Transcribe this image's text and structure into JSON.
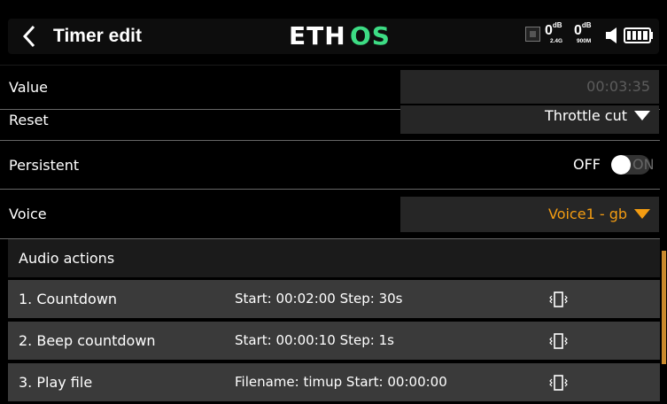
{
  "header": {
    "title": "Timer edit",
    "logo_text": "ETHOS",
    "signal1_value": "0",
    "signal1_unit": "dB",
    "signal1_band": "2.4G",
    "signal2_value": "0",
    "signal2_unit": "dB",
    "signal2_band": "900M",
    "icons": [
      "back-arrow-icon",
      "receiver-icon",
      "speaker-icon",
      "battery-icon"
    ]
  },
  "value_row": {
    "label": "Value",
    "value": "00:03:35"
  },
  "reset_row": {
    "label": "Reset",
    "value": "Throttle cut"
  },
  "persistent_row": {
    "label": "Persistent",
    "off_label": "OFF",
    "on_label": "ON",
    "state": "off"
  },
  "voice_row": {
    "label": "Voice",
    "value": "Voice1 - gb"
  },
  "audio_actions": {
    "title": "Audio actions",
    "items": [
      {
        "name": "1. Countdown",
        "detail": "Start: 00:02:00 Step: 30s",
        "icon": "vibrate-icon"
      },
      {
        "name": "2. Beep countdown",
        "detail": "Start: 00:00:10 Step: 1s",
        "icon": "vibrate-icon"
      },
      {
        "name": "3. Play file",
        "detail": "Filename: timup Start: 00:00:00",
        "icon": "vibrate-icon"
      }
    ]
  },
  "colors": {
    "background": "#000000",
    "field": "#262626",
    "row": "#3a3a3a",
    "accent_orange": "#f39c12",
    "logo_green": "#3ddc84"
  }
}
